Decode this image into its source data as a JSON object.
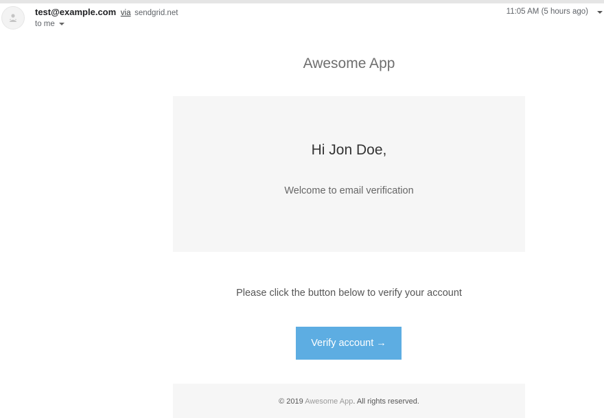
{
  "header": {
    "sender_email": "test@example.com",
    "via_label": "via",
    "via_domain": "sendgrid.net",
    "recipient_label": "to me",
    "timestamp": "11:05 AM (5 hours ago)",
    "icons": [
      "avatar-icon",
      "recipient-caret-icon",
      "more-options-caret-icon"
    ]
  },
  "email": {
    "app_title": "Awesome App",
    "greeting": "Hi Jon Doe,",
    "welcome_text": "Welcome to email verification",
    "instruction": "Please click the button below to verify your account",
    "verify_button_label": "Verify account →",
    "footer": {
      "prefix": "© 2019 ",
      "link_text": "Awesome App",
      "suffix": ". All rights reserved."
    }
  },
  "colors": {
    "button_bg": "#5dade2",
    "panel_bg": "#f6f6f6",
    "title_text": "#6e6e6e"
  }
}
